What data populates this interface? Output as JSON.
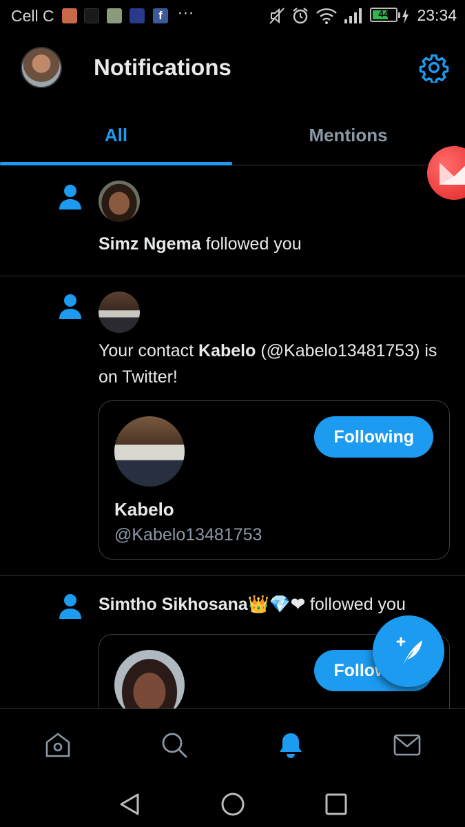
{
  "status_bar": {
    "carrier": "Cell C",
    "more": "···",
    "battery_level": "44",
    "time": "23:34"
  },
  "header": {
    "title": "Notifications"
  },
  "tabs": [
    {
      "label": "All",
      "active": true
    },
    {
      "label": "Mentions",
      "active": false
    }
  ],
  "notifications": [
    {
      "name": "Simz Ngema",
      "action": " followed you"
    },
    {
      "prefix": "Your contact ",
      "name": "Kabelo",
      "suffix": " (@Kabelo13481753) is on Twitter!",
      "card": {
        "name": "Kabelo",
        "handle": "@Kabelo13481753",
        "button_label": "Following"
      }
    },
    {
      "name": "Simtho Sikhosana👑💎❤",
      "action": " followed you",
      "card": {
        "button_label": "Following"
      }
    }
  ],
  "colors": {
    "accent": "#1d9bf0",
    "background": "#000000",
    "divider": "#2f3336",
    "secondary_text": "#8b98a5"
  },
  "icons": {
    "bottom_nav": [
      "home-icon",
      "search-icon",
      "bell-icon",
      "mail-icon"
    ],
    "system_nav": [
      "back-icon",
      "home-circle-icon",
      "recents-icon"
    ]
  }
}
